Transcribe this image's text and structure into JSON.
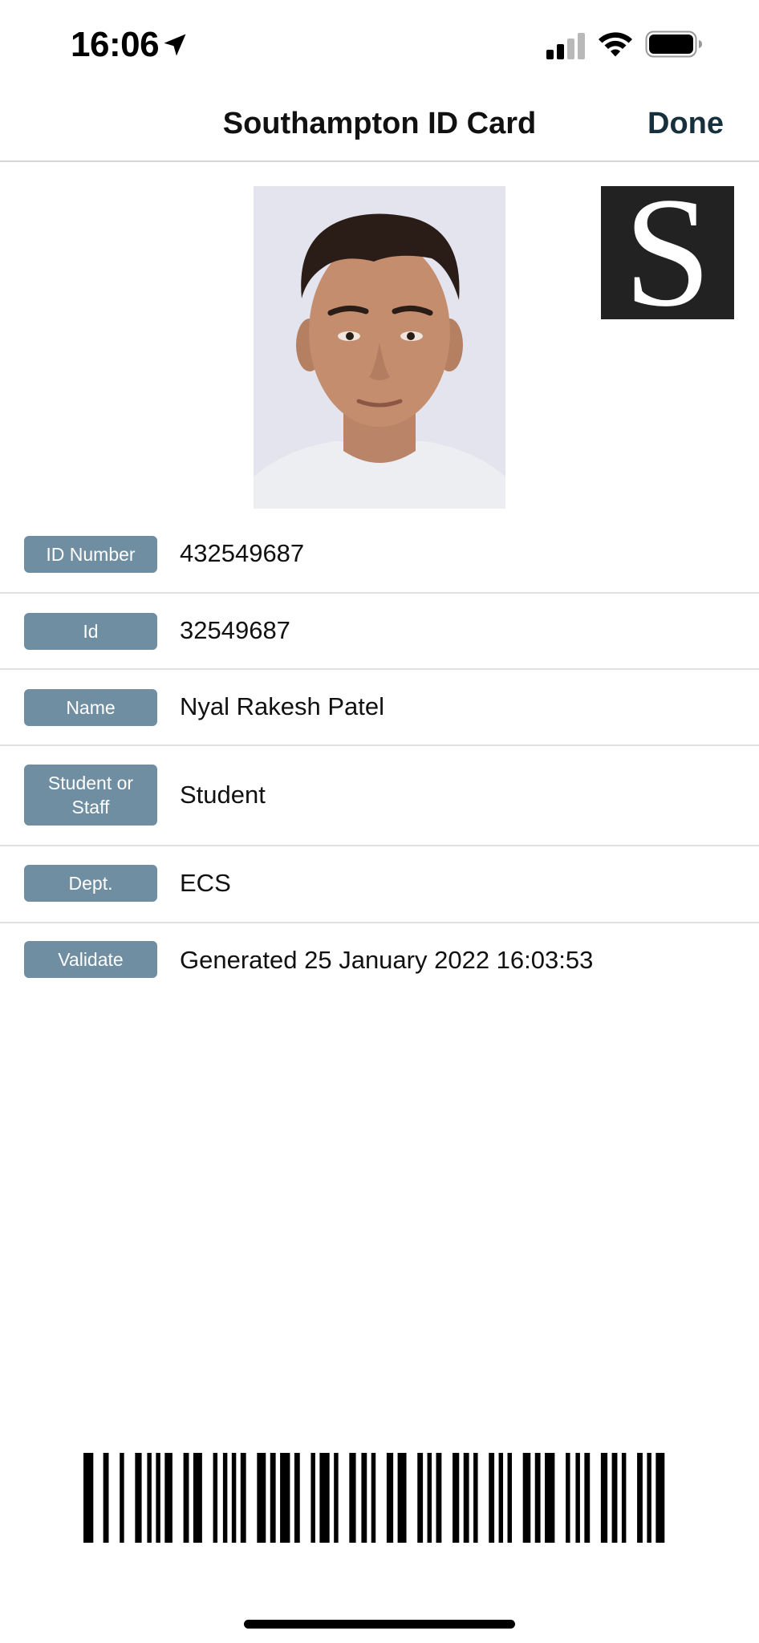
{
  "status_bar": {
    "time": "16:06",
    "icons": [
      "location-arrow-icon",
      "cellular-signal-icon",
      "wifi-icon",
      "battery-icon"
    ]
  },
  "nav": {
    "title": "Southampton ID Card",
    "done_label": "Done"
  },
  "logo": {
    "letter": "S"
  },
  "fields": [
    {
      "label": "ID Number",
      "value": "432549687"
    },
    {
      "label": "Id",
      "value": "32549687"
    },
    {
      "label": "Name",
      "value": "Nyal Rakesh Patel"
    },
    {
      "label": "Student or Staff",
      "value": "Student"
    },
    {
      "label": "Dept.",
      "value": "ECS"
    },
    {
      "label": "Validate",
      "value": "Generated 25 January 2022 16:03:53"
    }
  ],
  "colors": {
    "label_background": "#6f8ea2",
    "done_text": "#17303d",
    "logo_background": "#222222"
  }
}
